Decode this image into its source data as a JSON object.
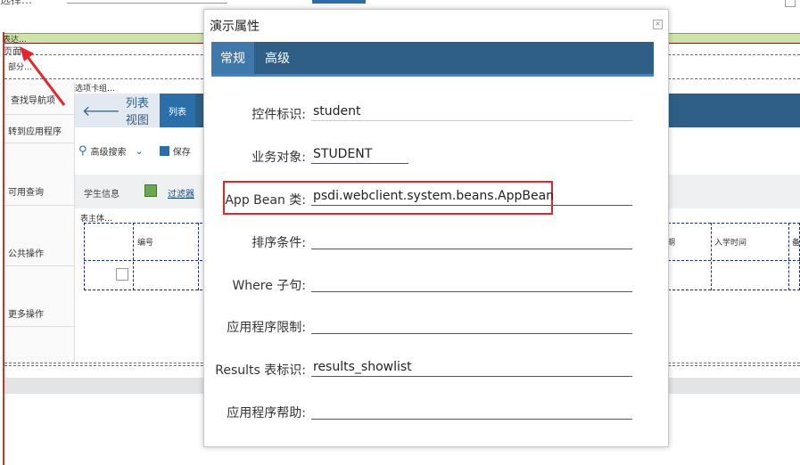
{
  "background": {
    "top_label": "选择…",
    "green_band_label": "表达…",
    "page_label": "页面",
    "section_label": "部分…",
    "tab_group_label": "选项卡组…",
    "sidebar": [
      {
        "label": "查找导航项"
      },
      {
        "label": "转到应用程序"
      },
      {
        "label": "可用查询"
      },
      {
        "label": "公共操作"
      },
      {
        "label": "更多操作"
      }
    ],
    "tabs": {
      "list_view": "列表视图",
      "list": "列表"
    },
    "toolbar": {
      "advanced_search": "高级搜索",
      "save": "保存"
    },
    "filter_row": {
      "title": "学生信息",
      "filter": "过滤器"
    },
    "table_label": "表主体…",
    "columns": [
      "编号",
      "期",
      "入学时间",
      "备"
    ]
  },
  "modal": {
    "title": "演示属性",
    "close": "×",
    "tabs": [
      {
        "label": "常规",
        "active": true
      },
      {
        "label": "高级",
        "active": false
      }
    ],
    "fields": [
      {
        "label": "控件标识:",
        "value": "student"
      },
      {
        "label": "业务对象:",
        "value": "STUDENT"
      },
      {
        "label": "App Bean 类:",
        "value": "psdi.webclient.system.beans.AppBean"
      },
      {
        "label": "排序条件:",
        "value": ""
      },
      {
        "label": "Where 子句:",
        "value": ""
      },
      {
        "label": "应用程序限制:",
        "value": ""
      },
      {
        "label": "Results 表标识:",
        "value": "results_showlist"
      },
      {
        "label": "应用程序帮助:",
        "value": ""
      }
    ]
  },
  "colors": {
    "accent": "#2f5f86",
    "annotation": "#e3262b",
    "green_band": "#cfe3a9"
  }
}
